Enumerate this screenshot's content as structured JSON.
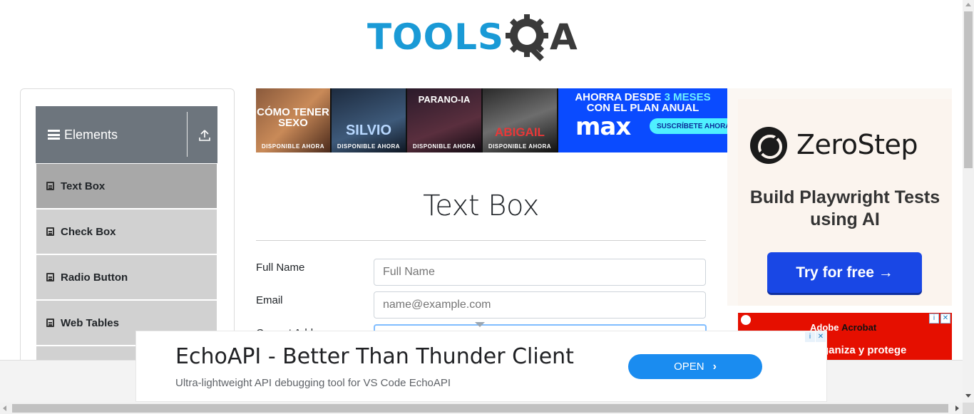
{
  "logo": {
    "part1": "TOOLS",
    "part2": "A"
  },
  "sidebar": {
    "group_title": "Elements",
    "items": [
      {
        "label": "Text Box",
        "active": true
      },
      {
        "label": "Check Box",
        "active": false
      },
      {
        "label": "Radio Button",
        "active": false
      },
      {
        "label": "Web Tables",
        "active": false
      }
    ]
  },
  "top_ad": {
    "posters": [
      {
        "title": "CÓMO TENER SEXO",
        "tag": "DISPONIBLE AHORA"
      },
      {
        "title": "SILVIO",
        "tag": "DISPONIBLE AHORA"
      },
      {
        "title": "PARANO-IA",
        "tag": "DISPONIBLE AHORA"
      },
      {
        "title": "ABIGAIL",
        "tag": "DISPONIBLE AHORA"
      }
    ],
    "promo_line1_prefix": "AHORRA DESDE ",
    "promo_line1_highlight": "3 MESES",
    "promo_line2": "CON EL PLAN ANUAL",
    "brand": "max",
    "cta": "SUSCRÍBETE AHORA"
  },
  "form": {
    "title": "Text Box",
    "fields": [
      {
        "label": "Full Name",
        "placeholder": "Full Name",
        "value": ""
      },
      {
        "label": "Email",
        "placeholder": "name@example.com",
        "value": ""
      },
      {
        "label": "Current Address"
      }
    ]
  },
  "right_ad": {
    "brand": "ZeroStep",
    "tagline": "Build Playwright Tests using AI",
    "button": "Try for free →",
    "secondary_line1_a": "Adobe ",
    "secondary_line1_b": "Acrobat",
    "secondary_line2": "ganiza y protege",
    "ad_choice_info": "i",
    "ad_choice_close": "✕"
  },
  "bottom_ad": {
    "headline": "EchoAPI - Better Than Thunder Client",
    "subtext": "Ultra-lightweight API debugging tool for VS Code EchoAPI",
    "button": "OPEN",
    "chevron": "›",
    "info": "i",
    "close": "✕"
  },
  "colors": {
    "logo_blue": "#1a9ad6",
    "sidebar_header": "#6d757d",
    "menu_active": "#a8a8a8",
    "menu_item": "#d1d1d1",
    "cta_blue": "#1947e5",
    "open_blue": "#1a8cf0"
  }
}
